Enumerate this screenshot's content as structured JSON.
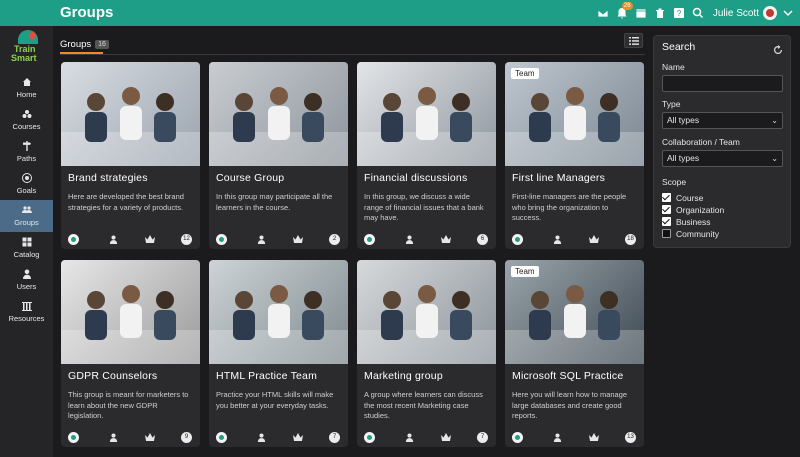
{
  "header": {
    "title": "Groups",
    "notification_count": "26",
    "user_name": "Julie Scott"
  },
  "sidebar": {
    "logo_line1": "Train",
    "logo_line2": "Smart",
    "items": [
      {
        "label": "Home",
        "icon": "home-icon"
      },
      {
        "label": "Courses",
        "icon": "courses-icon"
      },
      {
        "label": "Paths",
        "icon": "paths-icon"
      },
      {
        "label": "Goals",
        "icon": "goals-icon"
      },
      {
        "label": "Groups",
        "icon": "groups-icon",
        "active": true
      },
      {
        "label": "Catalog",
        "icon": "catalog-icon"
      },
      {
        "label": "Users",
        "icon": "users-icon"
      },
      {
        "label": "Resources",
        "icon": "resources-icon"
      }
    ]
  },
  "main": {
    "tab_label": "Groups",
    "tab_count": "16"
  },
  "cards": [
    {
      "title": "Brand strategies",
      "desc": "Here are developed the best brand strategies for a variety of products.",
      "team": "",
      "count": "12"
    },
    {
      "title": "Course Group",
      "desc": "In this group may participate all the learners in the course.",
      "team": "",
      "count": "2"
    },
    {
      "title": "Financial discussions",
      "desc": "In this group, we discuss a wide range of financial issues that a bank may have.",
      "team": "",
      "count": "6"
    },
    {
      "title": "First line Managers",
      "desc": "First-line managers are the people who bring the organization to success.",
      "team": "Team",
      "count": "18"
    },
    {
      "title": "GDPR Counselors",
      "desc": "This group is meant for marketers to learn about the new GDPR legislation.",
      "team": "",
      "count": "9"
    },
    {
      "title": "HTML Practice Team",
      "desc": "Practice your HTML skills will make you better at your everyday tasks.",
      "team": "",
      "count": "7"
    },
    {
      "title": "Marketing group",
      "desc": "A group where learners can discuss the most recent Marketing case studies.",
      "team": "",
      "count": "7"
    },
    {
      "title": "Microsoft SQL Practice",
      "desc": "Here you will learn how to manage large databases and create good reports.",
      "team": "Team",
      "count": "13"
    }
  ],
  "search": {
    "heading": "Search",
    "name_label": "Name",
    "name_value": "",
    "type_label": "Type",
    "type_value": "All types",
    "collab_label": "Collaboration / Team",
    "collab_value": "All types",
    "scope_label": "Scope",
    "scope": [
      {
        "label": "Course",
        "checked": true
      },
      {
        "label": "Organization",
        "checked": true
      },
      {
        "label": "Business",
        "checked": true
      },
      {
        "label": "Community",
        "checked": false
      }
    ]
  },
  "colors": {
    "topbar": "#1f9e87",
    "accent": "#f08a24",
    "active_nav": "#4b6b89"
  }
}
